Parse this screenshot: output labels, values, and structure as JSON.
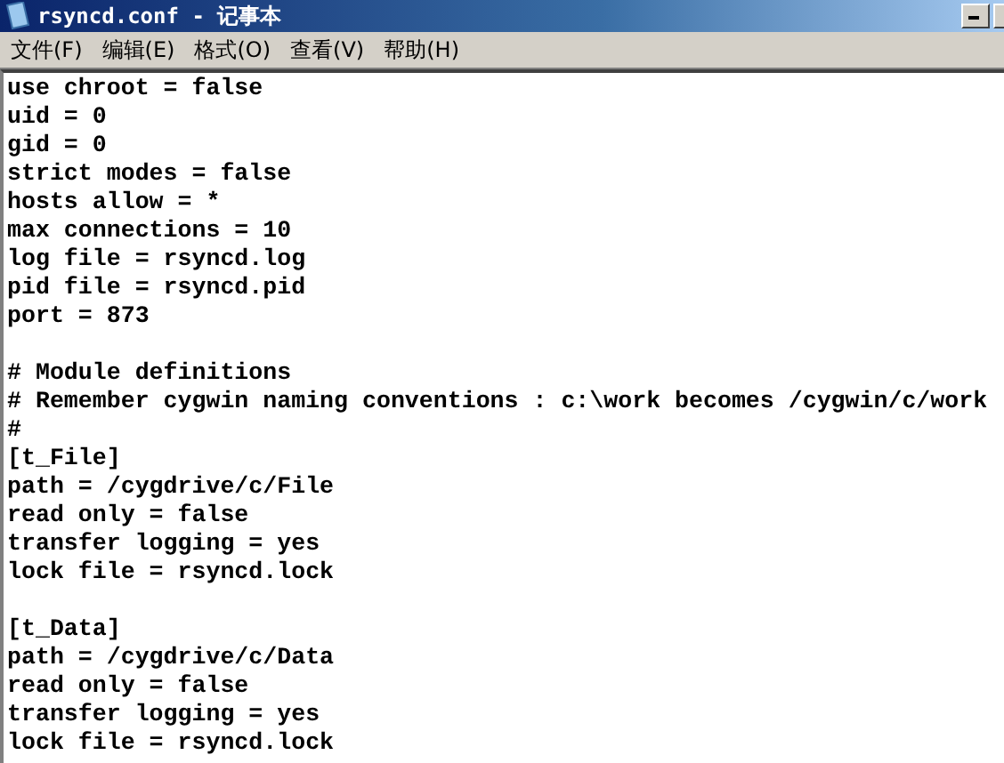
{
  "window": {
    "title": "rsyncd.conf - 记事本"
  },
  "menu": [
    "文件(F)",
    "编辑(E)",
    "格式(O)",
    "查看(V)",
    "帮助(H)"
  ],
  "editor": {
    "blocks": [
      [
        "use chroot = false",
        "uid = 0",
        "gid = 0",
        "strict modes = false",
        "hosts allow = *",
        "max connections = 10",
        "log file = rsyncd.log",
        "pid file = rsyncd.pid",
        "port = 873"
      ],
      [
        "# Module definitions",
        "# Remember cygwin naming conventions : c:\\work becomes /cygwin/c/work",
        "#",
        "[t_File]",
        "path = /cygdrive/c/File",
        "read only = false",
        "transfer logging = yes",
        "lock file = rsyncd.lock"
      ],
      [
        "[t_Data]",
        "path = /cygdrive/c/Data",
        "read only = false",
        "transfer logging = yes",
        "lock file = rsyncd.lock"
      ]
    ]
  }
}
